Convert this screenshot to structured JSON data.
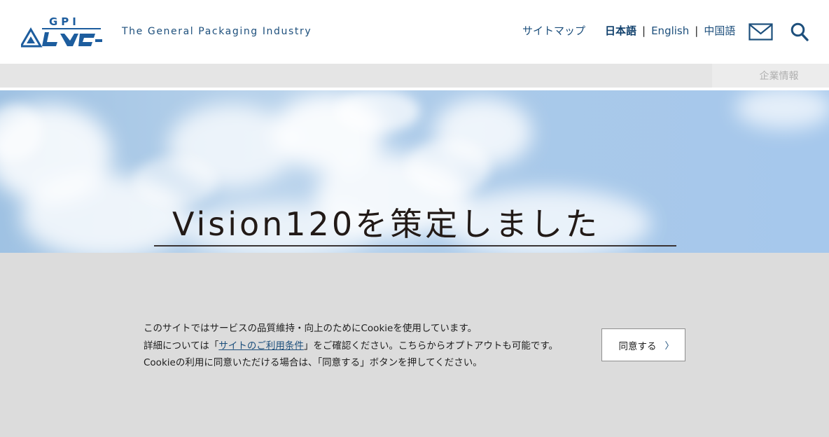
{
  "header": {
    "logo_alt": "GPI レンゴー",
    "tagline": "The General Packaging Industry",
    "sitemap_label": "サイトマップ",
    "languages": [
      {
        "label": "日本語",
        "active": true
      },
      {
        "label": "English",
        "active": false
      },
      {
        "label": "中国語",
        "active": false
      }
    ],
    "separator": "|",
    "mail_icon": "mail-icon",
    "search_icon": "search-icon"
  },
  "nav": {
    "items": [
      {
        "label": "企業情報"
      }
    ]
  },
  "hero": {
    "title": "Vision120を策定しました"
  },
  "cookie": {
    "line1": "このサイトではサービスの品質維持・向上のためにCookieを使用しています。",
    "line2_before": "詳細については「",
    "line2_link": "サイトのご利用条件",
    "line2_after": "」をご確認ください。こちらからオプトアウトも可能です。",
    "line3": "Cookieの利用に同意いただける場合は、「同意する」ボタンを押してください。",
    "agree_label": "同意する",
    "agree_chevron": "〉"
  },
  "colors": {
    "brand": "#1d4f7c",
    "overlay": "#dcdcdc",
    "navbar": "#e5e5e5"
  }
}
